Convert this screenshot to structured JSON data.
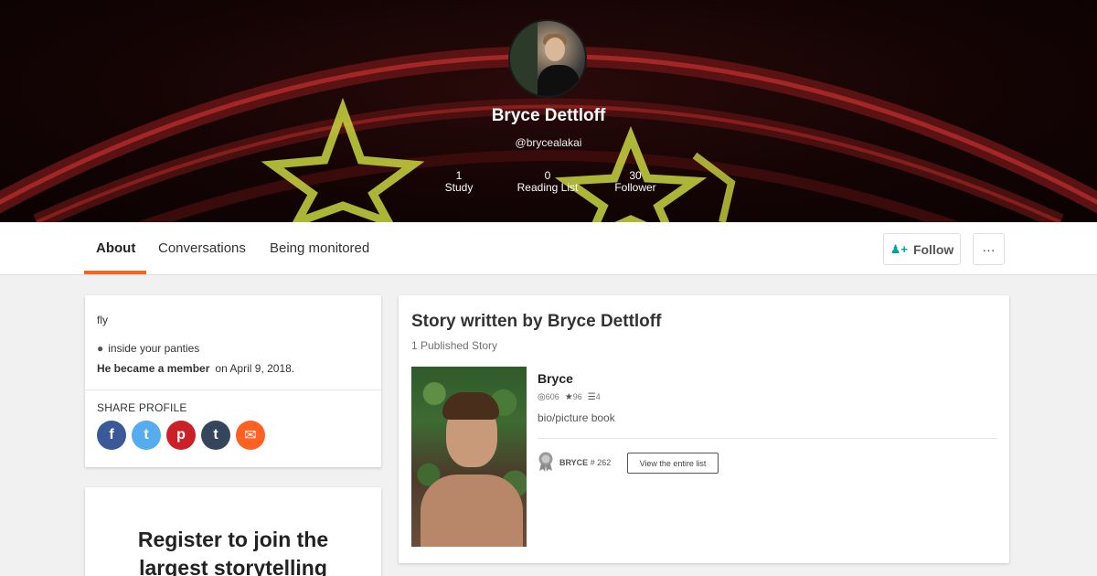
{
  "profile": {
    "name": "Bryce Dettloff",
    "handle": "@brycealakai",
    "stats": [
      {
        "value": "1",
        "label": "Study"
      },
      {
        "value": "0",
        "label": "Reading List"
      },
      {
        "value": "30",
        "label": "Follower"
      }
    ]
  },
  "nav": {
    "tabs": [
      {
        "label": "About",
        "active": true
      },
      {
        "label": "Conversations",
        "active": false
      },
      {
        "label": "Being monitored",
        "active": false
      }
    ],
    "follow_label": "Follow",
    "follow_icon": "add-user-icon",
    "more_label": "···",
    "accent_color": "#ff6122"
  },
  "about": {
    "bio": "fly",
    "location": "inside your panties",
    "member_label": "He became a member",
    "member_date": "on April 9, 2018.",
    "share_title": "SHARE PROFILE",
    "share_buttons": [
      {
        "icon": "facebook-icon",
        "glyph": "f",
        "color": "#3b5998"
      },
      {
        "icon": "twitter-icon",
        "glyph": "t",
        "color": "#55acee"
      },
      {
        "icon": "pinterest-icon",
        "glyph": "p",
        "color": "#cb2027"
      },
      {
        "icon": "tumblr-icon",
        "glyph": "t",
        "color": "#35465c"
      },
      {
        "icon": "email-icon",
        "glyph": "✉",
        "color": "#ff6122"
      }
    ]
  },
  "register": {
    "text_line1": "Register to join the",
    "text_line2": "largest storytelling"
  },
  "stories": {
    "heading": "Story written by Bryce Dettloff",
    "count_label": "1 Published Story",
    "items": [
      {
        "title": "Bryce",
        "reads": "606",
        "votes": "96",
        "parts": "4",
        "description": "bio/picture book",
        "rank_label": "BRYCE",
        "rank_value": "# 262",
        "view_list_label": "View the entire list"
      }
    ]
  }
}
